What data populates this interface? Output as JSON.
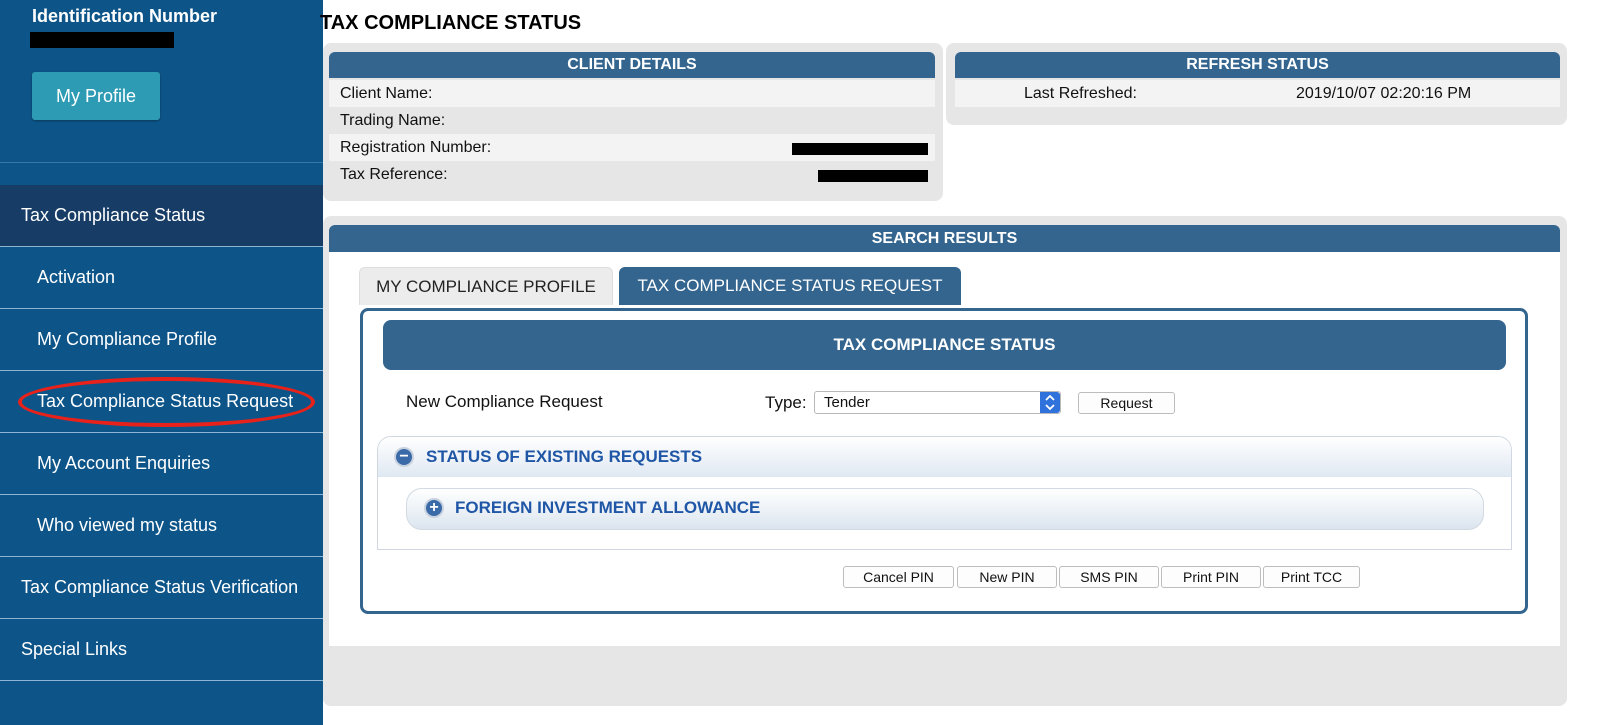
{
  "sidebar": {
    "id_label": "Identification Number",
    "profile_button": "My Profile",
    "items": [
      {
        "label": "Tax Compliance Status"
      },
      {
        "label": "Activation"
      },
      {
        "label": "My Compliance Profile"
      },
      {
        "label": "Tax Compliance Status Request"
      },
      {
        "label": "My Account Enquiries"
      },
      {
        "label": "Who viewed my status"
      },
      {
        "label": "Tax Compliance Status Verification"
      },
      {
        "label": "Special Links"
      }
    ]
  },
  "page_title": "TAX COMPLIANCE STATUS",
  "client_details": {
    "header": "CLIENT DETAILS",
    "rows": [
      {
        "label": "Client Name:"
      },
      {
        "label": "Trading Name:"
      },
      {
        "label": "Registration Number:"
      },
      {
        "label": "Tax Reference:"
      }
    ]
  },
  "refresh_status": {
    "header": "REFRESH STATUS",
    "label": "Last Refreshed:",
    "value": "2019/10/07 02:20:16 PM"
  },
  "search_results": {
    "header": "SEARCH RESULTS",
    "tabs": [
      {
        "label": "MY COMPLIANCE PROFILE"
      },
      {
        "label": "TAX COMPLIANCE STATUS REQUEST"
      }
    ],
    "panel_title": "TAX COMPLIANCE STATUS",
    "new_request_label": "New Compliance Request",
    "type_label": "Type:",
    "type_value": "Tender",
    "request_button": "Request",
    "existing_requests_title": "STATUS OF EXISTING REQUESTS",
    "foreign_allowance_title": "FOREIGN INVESTMENT ALLOWANCE",
    "buttons": [
      "Cancel PIN",
      "New PIN",
      "SMS PIN",
      "Print PIN",
      "Print TCC"
    ]
  },
  "colors": {
    "sidebar_bg": "#0d5589",
    "header_blue": "#33658f",
    "highlight_red": "#e8221a"
  }
}
